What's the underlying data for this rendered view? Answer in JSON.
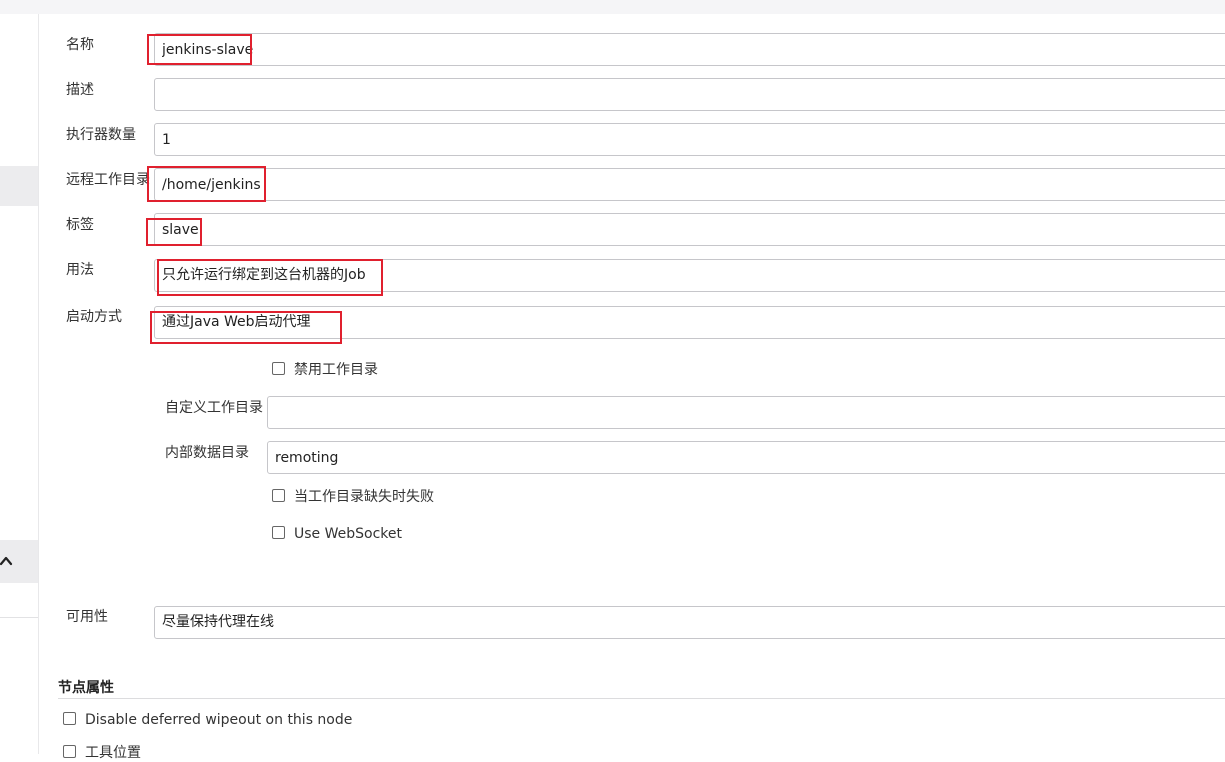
{
  "form": {
    "name": {
      "label": "名称",
      "value": "jenkins-slave"
    },
    "description": {
      "label": "描述",
      "value": ""
    },
    "executors": {
      "label": "执行器数量",
      "value": "1"
    },
    "remote_dir": {
      "label": "远程工作目录",
      "value": "/home/jenkins"
    },
    "labels": {
      "label": "标签",
      "value": "slave"
    },
    "usage": {
      "label": "用法",
      "value": "只允许运行绑定到这台机器的Job"
    },
    "launch": {
      "label": "启动方式",
      "value": "通过Java Web启动代理"
    },
    "disable_workdir": {
      "label": "禁用工作目录",
      "checked": false
    },
    "custom_workdir": {
      "label": "自定义工作目录",
      "value": ""
    },
    "internal_dir": {
      "label": "内部数据目录",
      "value": "remoting"
    },
    "fail_if_missing": {
      "label": "当工作目录缺失时失败",
      "checked": false
    },
    "websocket": {
      "label": "Use WebSocket",
      "checked": false
    },
    "availability": {
      "label": "可用性",
      "value": "尽量保持代理在线"
    }
  },
  "node_properties": {
    "title": "节点属性",
    "disable_wipeout": {
      "label": "Disable deferred wipeout on this node",
      "checked": false
    },
    "tool_locations": {
      "label": "工具位置",
      "checked": false
    }
  },
  "colors": {
    "highlight": "#e0202e",
    "border": "#c6c6ca"
  }
}
